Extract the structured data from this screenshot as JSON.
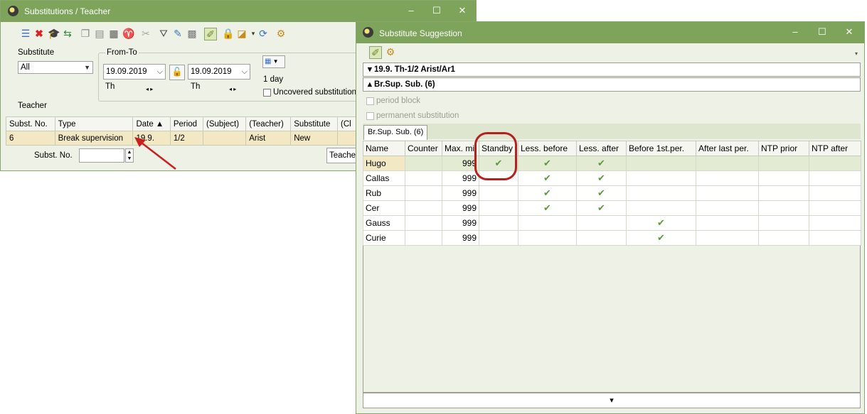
{
  "window1": {
    "title": "Substitutions / Teacher",
    "controls": {
      "minimize": "–",
      "maximize": "☐",
      "close": "✕"
    },
    "filter": {
      "substitute_label": "Substitute",
      "substitute_value": "All",
      "from_to_label": "From-To",
      "from_date": "19.09.2019",
      "to_date": "19.09.2019",
      "from_day": "Th",
      "to_day": "Th",
      "arrows": "◂ ▸",
      "period_label": "1 day",
      "uncovered_label": "Uncovered substitution",
      "teacher_label": "Teacher"
    },
    "table": {
      "headers": [
        "Subst. No.",
        "Type",
        "Date ▲",
        "Period",
        "(Subject)",
        "(Teacher)",
        "Substitute",
        "(Cl"
      ],
      "rows": [
        [
          "6",
          "Break supervision",
          "19.9.",
          "1/2",
          "",
          "Arist",
          "New",
          ""
        ]
      ]
    },
    "footer": {
      "subst_no_label": "Subst. No.",
      "subst_no_value": "",
      "teacher_button": "Teacher"
    }
  },
  "window2": {
    "title": "Substitute Suggestion",
    "controls": {
      "minimize": "–",
      "maximize": "☐",
      "close": "✕"
    },
    "bar1": "▾ 19.9. Th-1/2 Arist/Ar1",
    "bar2": "▴ Br.Sup. Sub. (6)",
    "period_block_label": "period block",
    "permanent_label": "permanent substitution",
    "tab_label": "Br.Sup. Sub. (6)",
    "table": {
      "headers": [
        "Name",
        "Counter",
        "Max. mi",
        "Standby",
        "Less. before",
        "Less. after",
        "Before 1st.per.",
        "After last per.",
        "NTP prior",
        "NTP after"
      ],
      "rows": [
        {
          "name": "Hugo",
          "max": "999",
          "standby": "✔",
          "before": "✔",
          "after": "✔",
          "first": ""
        },
        {
          "name": "Callas",
          "max": "999",
          "standby": "",
          "before": "✔",
          "after": "✔",
          "first": ""
        },
        {
          "name": "Rub",
          "max": "999",
          "standby": "",
          "before": "✔",
          "after": "✔",
          "first": ""
        },
        {
          "name": "Cer",
          "max": "999",
          "standby": "",
          "before": "✔",
          "after": "✔",
          "first": ""
        },
        {
          "name": "Gauss",
          "max": "999",
          "standby": "",
          "before": "",
          "after": "",
          "first": "✔"
        },
        {
          "name": "Curie",
          "max": "999",
          "standby": "",
          "before": "",
          "after": "",
          "first": "✔"
        }
      ]
    },
    "scroll_down": "▾"
  },
  "annotations": {
    "highlight_color": "#b5201f"
  }
}
